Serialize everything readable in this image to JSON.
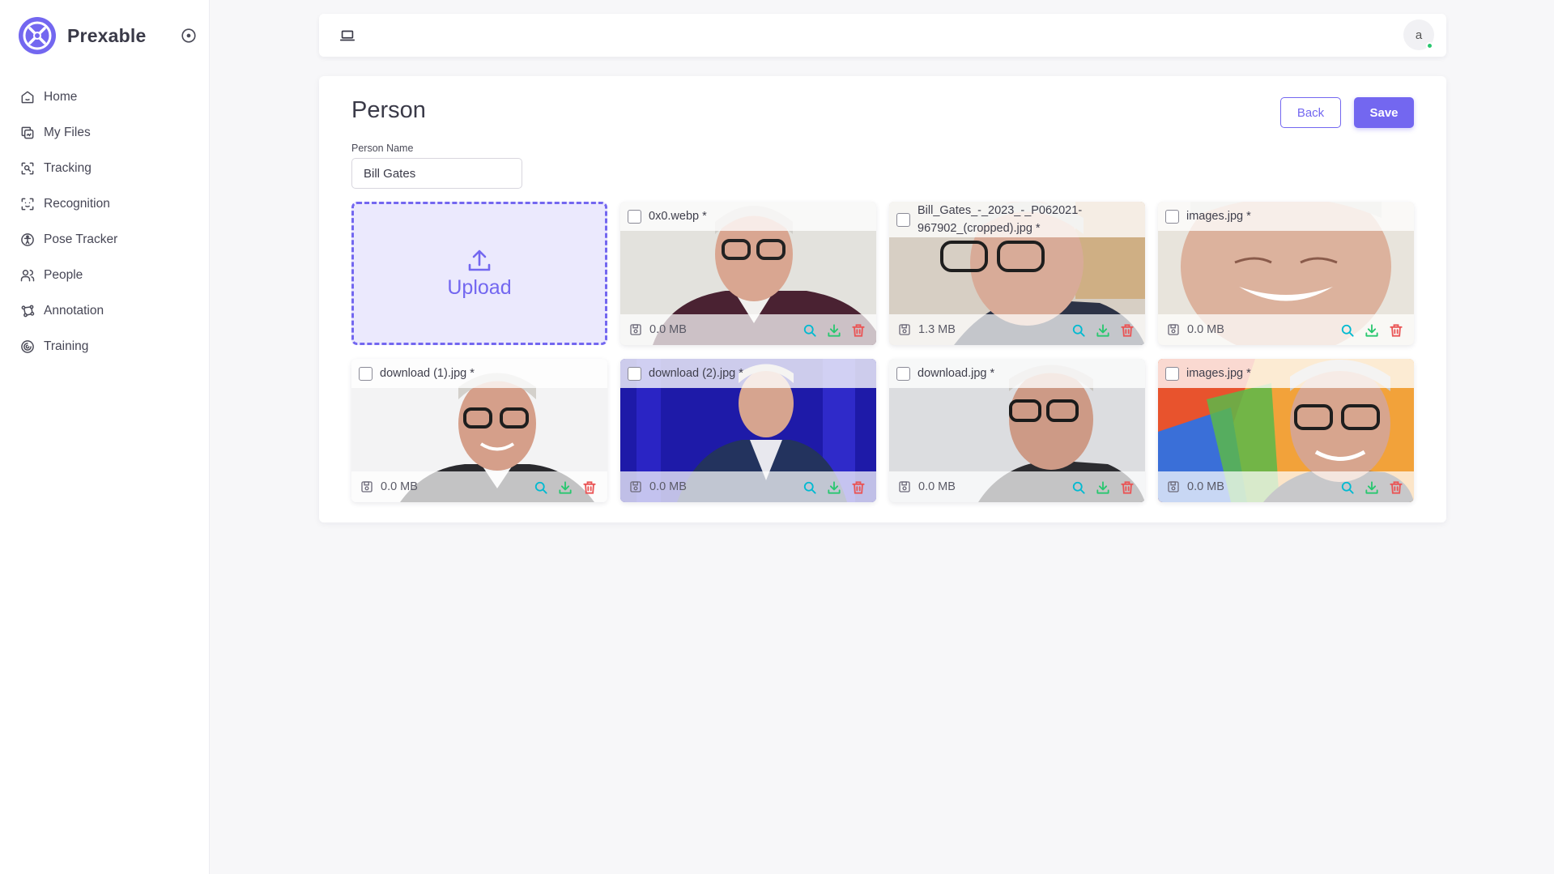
{
  "app": {
    "name": "Prexable"
  },
  "sidebar": {
    "items": [
      {
        "label": "Home",
        "icon": "home-icon"
      },
      {
        "label": "My Files",
        "icon": "files-icon"
      },
      {
        "label": "Tracking",
        "icon": "tracking-icon"
      },
      {
        "label": "Recognition",
        "icon": "recognition-icon"
      },
      {
        "label": "Pose Tracker",
        "icon": "pose-icon"
      },
      {
        "label": "People",
        "icon": "people-icon"
      },
      {
        "label": "Annotation",
        "icon": "annotation-icon"
      },
      {
        "label": "Training",
        "icon": "training-icon"
      }
    ]
  },
  "topbar": {
    "avatar_initial": "a",
    "status_color": "#28c76f"
  },
  "page": {
    "title": "Person",
    "back_label": "Back",
    "save_label": "Save",
    "field_label": "Person Name",
    "person_name": "Bill Gates",
    "upload_label": "Upload"
  },
  "images": [
    {
      "name": "0x0.webp *",
      "size": "0.0 MB"
    },
    {
      "name": "Bill_Gates_-_2023_-_P062021-967902_(cropped).jpg *",
      "size": "1.3 MB"
    },
    {
      "name": "images.jpg *",
      "size": "0.0 MB"
    },
    {
      "name": "download (1).jpg *",
      "size": "0.0 MB"
    },
    {
      "name": "download (2).jpg *",
      "size": "0.0 MB"
    },
    {
      "name": "download.jpg *",
      "size": "0.0 MB"
    },
    {
      "name": "images.jpg *",
      "size": "0.0 MB"
    }
  ],
  "colors": {
    "accent": "#7367f0",
    "search": "#00bad1",
    "download": "#28c76f",
    "delete": "#ea5455"
  }
}
